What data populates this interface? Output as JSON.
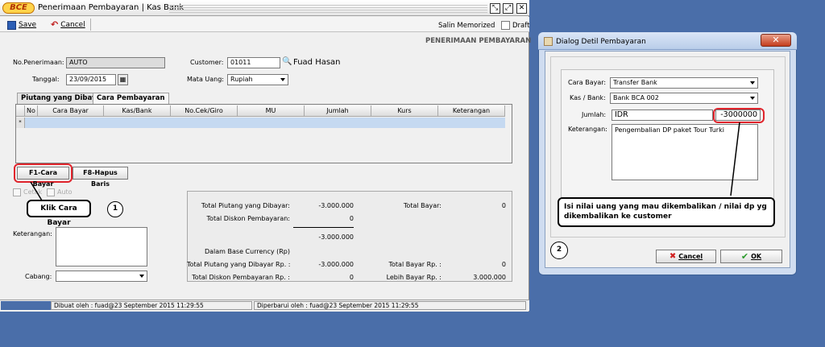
{
  "main": {
    "title": "Penerimaan Pembayaran | Kas Bank",
    "logo": "BCE",
    "toolbar": {
      "save": "Save",
      "cancel": "Cancel",
      "salin_memorized": "Salin Memorized",
      "draft": "Draft"
    },
    "section_title": "PENERIMAAN PEMBAYARAN",
    "form": {
      "no_penerimaan_label": "No.Penerimaan:",
      "no_penerimaan_value": "AUTO",
      "tanggal_label": "Tanggal:",
      "tanggal_value": "23/09/2015",
      "customer_label": "Customer:",
      "customer_code": "01011",
      "customer_name": "Fuad Hasan",
      "mata_uang_label": "Mata Uang:",
      "mata_uang_value": "Rupiah"
    },
    "tabs": [
      "Piutang yang Dibayar",
      "Cara Pembayaran"
    ],
    "grid": {
      "columns": [
        "No",
        "Cara Bayar",
        "Kas/Bank",
        "No.Cek/Giro",
        "MU",
        "Jumlah",
        "Kurs",
        "Keterangan"
      ],
      "row_marker": "*"
    },
    "buttons": {
      "cara_bayar": "F1-Cara Bayar",
      "hapus_baris": "F8-Hapus Baris"
    },
    "checkboxes": [
      "Cetak",
      "Auto"
    ],
    "callout1": "Klik Cara Bayar",
    "circle1": "1",
    "keterangan_label": "Keterangan:",
    "cabang_label": "Cabang:",
    "summary": {
      "total_piutang_label": "Total Piutang yang Dibayar:",
      "total_piutang_value": "-3.000.000",
      "total_diskon_label": "Total Diskon Pembayaran:",
      "total_diskon_value": "0",
      "subtotal_value": "-3.000.000",
      "total_bayar_label": "Total Bayar:",
      "total_bayar_value": "0",
      "base_currency_label": "Dalam Base Currency (Rp)",
      "total_piutang_rp_label": "Total Piutang yang Dibayar Rp. :",
      "total_piutang_rp_value": "-3.000.000",
      "total_bayar_rp_label": "Total Bayar Rp. :",
      "total_bayar_rp_value": "0",
      "total_diskon_rp_label": "Total Diskon Pembayaran Rp. :",
      "total_diskon_rp_value": "0",
      "lebih_bayar_label": "Lebih Bayar Rp. :",
      "lebih_bayar_value": "3.000.000"
    },
    "status": {
      "dibuat": "Dibuat oleh : fuad@23 September 2015  11:29:55",
      "diperbarui": "Diperbarui oleh : fuad@23 September 2015  11:29:55"
    }
  },
  "dialog": {
    "title": "Dialog Detil Pembayaran",
    "cara_bayar_label": "Cara Bayar:",
    "cara_bayar_value": "Transfer Bank",
    "kas_bank_label": "Kas / Bank:",
    "kas_bank_value": "Bank BCA 002",
    "jumlah_label": "Jumlah:",
    "jumlah_currency": "IDR",
    "jumlah_value": "-3000000",
    "keterangan_label": "Keterangan:",
    "keterangan_value": "Pengembalian DP paket Tour Turki",
    "callout2": "Isi nilai uang yang mau dikembalikan / nilai dp yg dikembalikan ke customer",
    "circle2": "2",
    "cancel": "Cancel",
    "ok": "OK"
  }
}
